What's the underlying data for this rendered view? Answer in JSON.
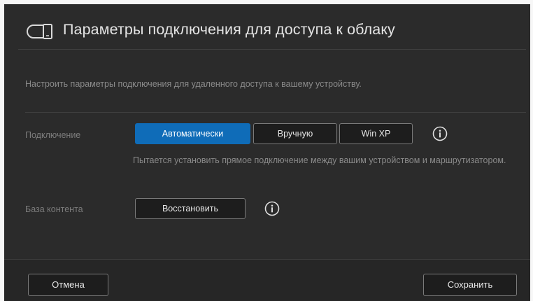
{
  "dialog": {
    "title": "Параметры подключения для доступа к облаку",
    "header_icon": "cloud-devices-icon",
    "description": "Настроить параметры подключения для удаленного доступа к вашему устройству."
  },
  "connection": {
    "label": "Подключение",
    "options": [
      "Автоматически",
      "Вручную",
      "Win XP"
    ],
    "selected": "Автоматически",
    "info_icon": "info-icon",
    "hint": "Пытается установить прямое подключение между вашим устройством и маршрутизатором."
  },
  "content_db": {
    "label": "База контента",
    "restore_label": "Восстановить",
    "info_icon": "info-icon"
  },
  "footer": {
    "cancel_label": "Отмена",
    "save_label": "Сохранить"
  },
  "colors": {
    "dialog_bg": "#2b2b2b",
    "accent": "#0f6cb8",
    "text": "#e6e6e6",
    "muted_text": "#8a8a8a"
  }
}
